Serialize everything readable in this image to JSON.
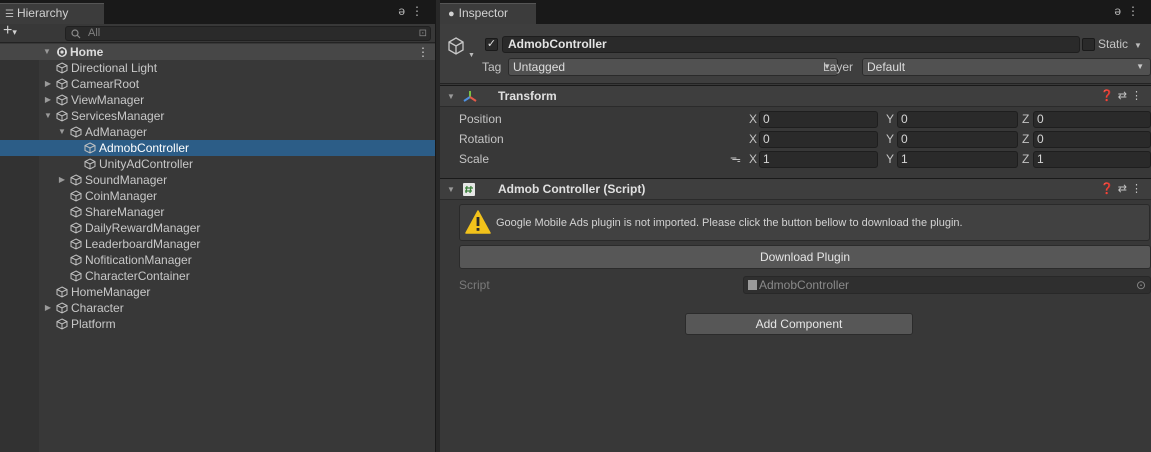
{
  "hierarchy": {
    "tab_label": "Hierarchy",
    "search_placeholder": "All",
    "add_icon": "plus-icon",
    "scene": {
      "label": "Home"
    },
    "items": [
      {
        "label": "Directional Light",
        "depth": 1,
        "arrow": ""
      },
      {
        "label": "CamearRoot",
        "depth": 1,
        "arrow": "▶"
      },
      {
        "label": "ViewManager",
        "depth": 1,
        "arrow": "▶"
      },
      {
        "label": "ServicesManager",
        "depth": 1,
        "arrow": "▼"
      },
      {
        "label": "AdManager",
        "depth": 2,
        "arrow": "▼"
      },
      {
        "label": "AdmobController",
        "depth": 3,
        "arrow": "",
        "selected": true
      },
      {
        "label": "UnityAdController",
        "depth": 3,
        "arrow": ""
      },
      {
        "label": "SoundManager",
        "depth": 2,
        "arrow": "▶"
      },
      {
        "label": "CoinManager",
        "depth": 2,
        "arrow": ""
      },
      {
        "label": "ShareManager",
        "depth": 2,
        "arrow": ""
      },
      {
        "label": "DailyRewardManager",
        "depth": 2,
        "arrow": ""
      },
      {
        "label": "LeaderboardManager",
        "depth": 2,
        "arrow": ""
      },
      {
        "label": "NofiticationManager",
        "depth": 2,
        "arrow": ""
      },
      {
        "label": "CharacterContainer",
        "depth": 2,
        "arrow": ""
      },
      {
        "label": "HomeManager",
        "depth": 1,
        "arrow": ""
      },
      {
        "label": "Character",
        "depth": 1,
        "arrow": "▶"
      },
      {
        "label": "Platform",
        "depth": 1,
        "arrow": ""
      }
    ]
  },
  "inspector": {
    "tab_label": "Inspector",
    "object_name": "AdmobController",
    "active": true,
    "static_label": "Static",
    "tag_label": "Tag",
    "tag_value": "Untagged",
    "layer_label": "Layer",
    "layer_value": "Default",
    "transform": {
      "title": "Transform",
      "position": {
        "label": "Position",
        "x": "0",
        "y": "0",
        "z": "0"
      },
      "rotation": {
        "label": "Rotation",
        "x": "0",
        "y": "0",
        "z": "0"
      },
      "scale": {
        "label": "Scale",
        "x": "1",
        "y": "1",
        "z": "1"
      }
    },
    "script_component": {
      "title": "Admob Controller (Script)",
      "warning": "Google Mobile Ads plugin is not imported. Please click the button bellow to download the plugin.",
      "download_button": "Download Plugin",
      "script_label": "Script",
      "script_value": "AdmobController"
    },
    "add_component_button": "Add Component"
  },
  "axis_labels": {
    "x": "X",
    "y": "Y",
    "z": "Z"
  },
  "colors": {
    "selection": "#2c5d87",
    "warning": "#f2c21b",
    "panel": "#383838"
  }
}
